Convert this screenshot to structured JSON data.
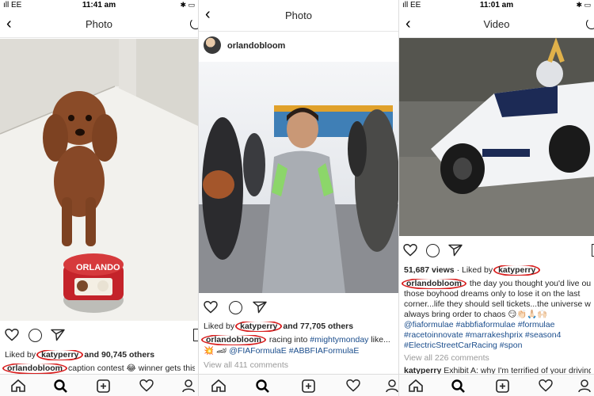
{
  "panel1": {
    "status": {
      "carrier": "ıll EE",
      "time": "11:41 am",
      "right": "✱ ▭"
    },
    "nav": {
      "back": "‹",
      "title": "Photo"
    },
    "likes": {
      "prefix": "Liked by",
      "user": "katyperry",
      "suffix": "and 90,745 others"
    },
    "caption": {
      "user": "orlandobloom",
      "text": "caption contest 😂 winner gets this"
    }
  },
  "panel2": {
    "status": {
      "carrier": "",
      "time": "",
      "right": ""
    },
    "nav": {
      "back": "‹",
      "title": "Photo"
    },
    "header": {
      "username": "orlandobloom"
    },
    "likes": {
      "prefix": "Liked by",
      "user": "katyperry",
      "suffix": "and 77,705 others"
    },
    "caption": {
      "user": "orlandobloom",
      "text_1": "racing into",
      "hashtag_1": "#mightymonday",
      "text_2": "like...",
      "emoji": "💥 🏎",
      "mention": "@FIAFormulaE",
      "hashtag_2": "#ABBFIAFormulaE"
    },
    "comments": "View all 411 comments"
  },
  "panel3": {
    "status": {
      "carrier": "ıll EE",
      "time": "11:01 am",
      "right": "✱ ▭"
    },
    "nav": {
      "back": "‹",
      "title": "Video"
    },
    "views": "51,687 views",
    "likes": {
      "prefix": "· Liked by",
      "user": "katyperry"
    },
    "caption": {
      "user": "orlandobloom",
      "line1": "the day you thought you'd live out",
      "line2": "those boyhood dreams only to lose it on the last",
      "line3": "corner...life they should sell tickets...the universe wi",
      "line4": "always bring order to chaos 😏👏🏻🙏🏻🙌🏻",
      "tags1": "@fiaformulae #abbfiaformulae #formulae",
      "tags2": "#racetoinnovate #marrakeshprix #season4",
      "tags3": "#ElectricStreetCarRacing #spon"
    },
    "comments": "View all 226 comments",
    "comment": {
      "user": "katyperry",
      "text": "Exhibit A: why I'm terrified of your driving"
    }
  },
  "colors": {
    "accent": "#d81f1f",
    "link": "#1a4d8c",
    "muted": "#9a9a9a"
  },
  "icons": [
    "back-arrow-icon",
    "refresh-icon",
    "heart-icon",
    "comment-icon",
    "share-icon",
    "bookmark-icon",
    "home-icon",
    "search-icon",
    "add-icon",
    "activity-icon",
    "profile-icon"
  ]
}
